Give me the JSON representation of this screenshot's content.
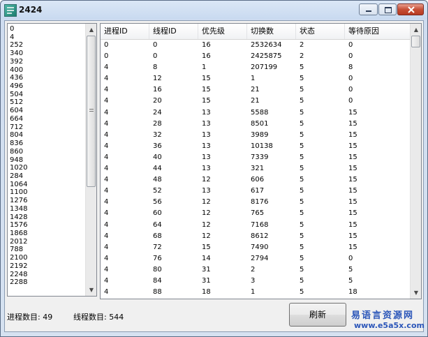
{
  "window": {
    "title": "2424"
  },
  "process_list": [
    "0",
    "4",
    "252",
    "340",
    "392",
    "400",
    "436",
    "496",
    "504",
    "512",
    "604",
    "664",
    "712",
    "804",
    "836",
    "860",
    "948",
    "1020",
    "284",
    "1064",
    "1100",
    "1276",
    "1348",
    "1428",
    "1576",
    "1868",
    "2012",
    "788",
    "2100",
    "2192",
    "2248",
    "2288"
  ],
  "thread_table": {
    "headers": [
      "进程ID",
      "线程ID",
      "优先级",
      "切换数",
      "状态",
      "等待原因"
    ],
    "rows": [
      [
        "0",
        "0",
        "16",
        "2532634",
        "2",
        "0"
      ],
      [
        "0",
        "0",
        "16",
        "2425875",
        "2",
        "0"
      ],
      [
        "4",
        "8",
        "1",
        "207199",
        "5",
        "8"
      ],
      [
        "4",
        "12",
        "15",
        "1",
        "5",
        "0"
      ],
      [
        "4",
        "16",
        "15",
        "21",
        "5",
        "0"
      ],
      [
        "4",
        "20",
        "15",
        "21",
        "5",
        "0"
      ],
      [
        "4",
        "24",
        "13",
        "5588",
        "5",
        "15"
      ],
      [
        "4",
        "28",
        "13",
        "8501",
        "5",
        "15"
      ],
      [
        "4",
        "32",
        "13",
        "3989",
        "5",
        "15"
      ],
      [
        "4",
        "36",
        "13",
        "10138",
        "5",
        "15"
      ],
      [
        "4",
        "40",
        "13",
        "7339",
        "5",
        "15"
      ],
      [
        "4",
        "44",
        "13",
        "321",
        "5",
        "15"
      ],
      [
        "4",
        "48",
        "12",
        "606",
        "5",
        "15"
      ],
      [
        "4",
        "52",
        "13",
        "617",
        "5",
        "15"
      ],
      [
        "4",
        "56",
        "12",
        "8176",
        "5",
        "15"
      ],
      [
        "4",
        "60",
        "12",
        "765",
        "5",
        "15"
      ],
      [
        "4",
        "64",
        "12",
        "7168",
        "5",
        "15"
      ],
      [
        "4",
        "68",
        "12",
        "8612",
        "5",
        "15"
      ],
      [
        "4",
        "72",
        "15",
        "7490",
        "5",
        "15"
      ],
      [
        "4",
        "76",
        "14",
        "2794",
        "5",
        "0"
      ],
      [
        "4",
        "80",
        "31",
        "2",
        "5",
        "5"
      ],
      [
        "4",
        "84",
        "31",
        "3",
        "5",
        "5"
      ],
      [
        "4",
        "88",
        "18",
        "1",
        "5",
        "18"
      ]
    ]
  },
  "footer": {
    "process_count_text": "进程数目: 49",
    "thread_count_text": "线程数目: 544",
    "refresh_label": "刷新"
  },
  "watermark": {
    "cn": "易语言资源网",
    "url": "www.e5a5x.com"
  },
  "colors": {
    "watermark": "#2b56b9",
    "title_bar": "#c9daf0",
    "close_button": "#c74f36"
  }
}
